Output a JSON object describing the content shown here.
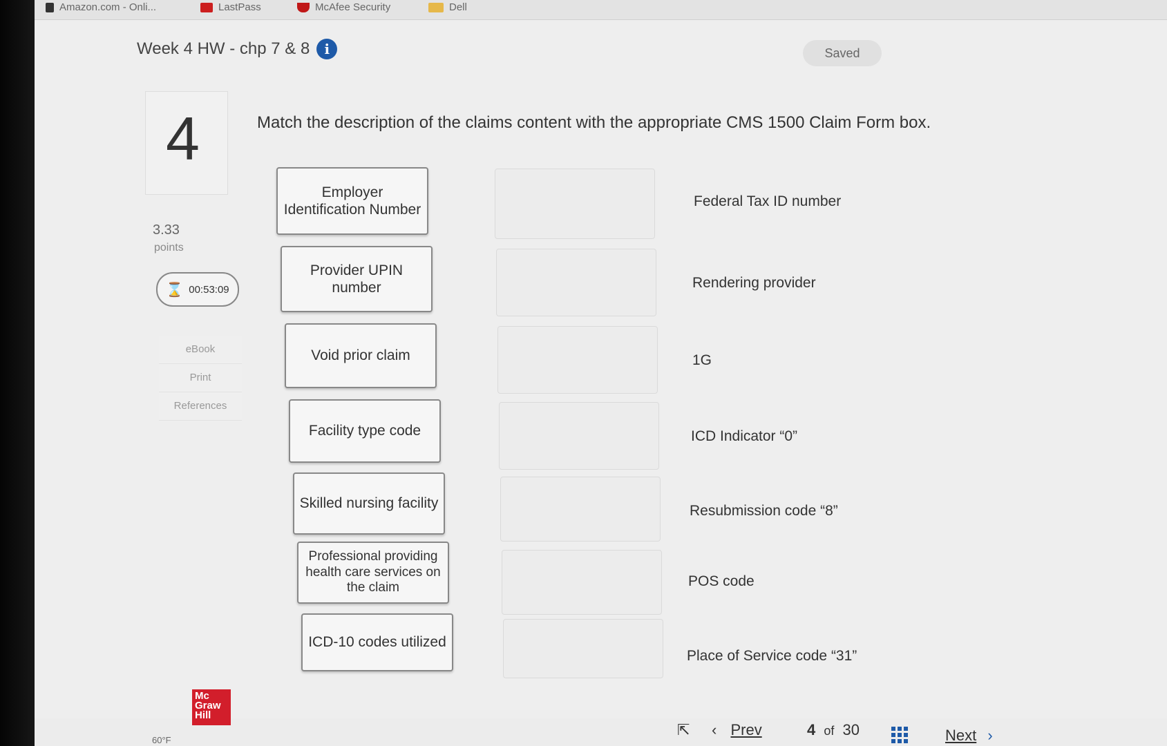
{
  "bookmarks": [
    {
      "label": "Amazon.com - Onli...",
      "color": "#333333"
    },
    {
      "label": "LastPass",
      "color": "#cc1f1f"
    },
    {
      "label": "McAfee Security",
      "color": "#c01818"
    },
    {
      "label": "Dell",
      "color": "#e6b84a"
    }
  ],
  "header": {
    "title": "Week 4 HW - chp 7 & 8",
    "info_icon": "i",
    "status": "Saved"
  },
  "question": {
    "number": "4",
    "points_value": "3.33",
    "points_label": "points",
    "timer": "00:53:09",
    "prompt": "Match the description of the claims content with the appropriate CMS 1500 Claim Form box."
  },
  "side_links": [
    "eBook",
    "Print",
    "References"
  ],
  "answers": [
    "Employer Identification Number",
    "Provider UPIN number",
    "Void prior claim",
    "Facility type code",
    "Skilled nursing facility",
    "Professional providing health care services on the claim",
    "ICD-10 codes utilized"
  ],
  "targets": [
    "Federal Tax ID number",
    "Rendering provider",
    "1G",
    "ICD Indicator “0”",
    "Resubmission code “8”",
    "POS code",
    "Place of Service code “31”"
  ],
  "footer": {
    "logo": "Mc Graw Hill",
    "temperature": "60°F",
    "prev_label": "Prev",
    "current_page": "4",
    "of_label": "of",
    "total_pages": "30",
    "next_label": "Next"
  },
  "colors": {
    "accent": "#1e5aa8",
    "brand": "#d21e2b"
  }
}
